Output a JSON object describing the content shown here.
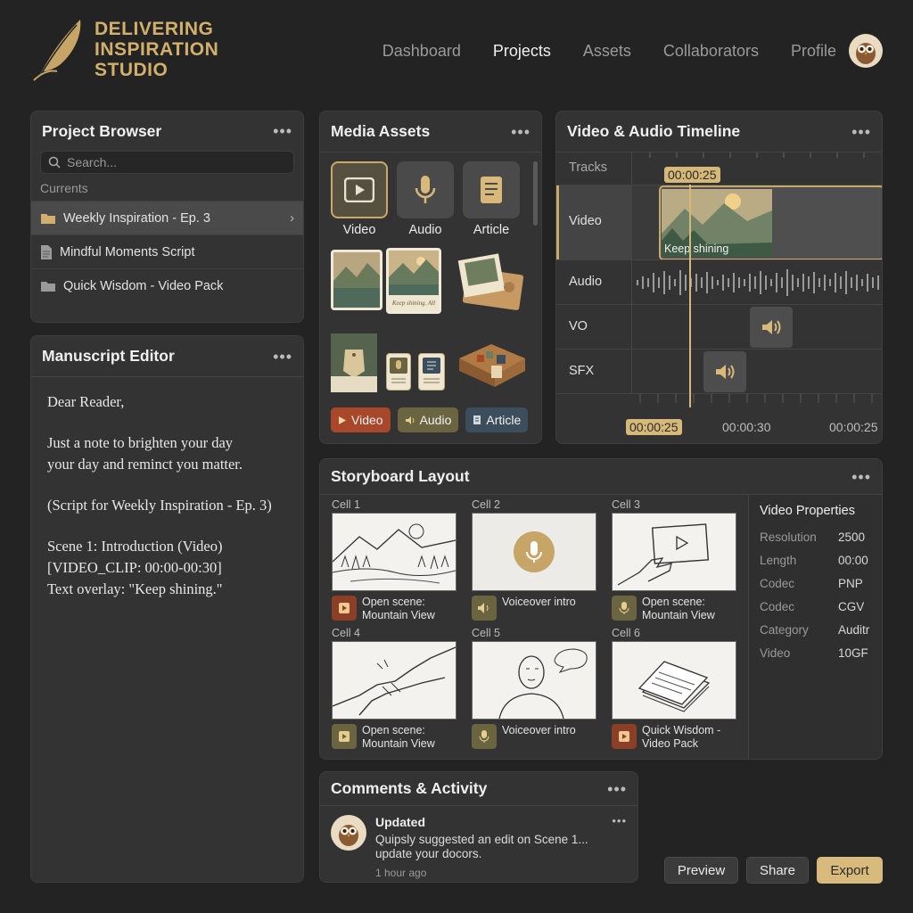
{
  "brand": {
    "line1": "DELIVERING",
    "line2": "INSPIRATION",
    "line3": "STUDIO",
    "color": "#d2b06b"
  },
  "nav": {
    "items": [
      "Dashboard",
      "Projects",
      "Assets",
      "Collaborators",
      "Profile"
    ],
    "active": "Projects"
  },
  "project_browser": {
    "title": "Project Browser",
    "search_placeholder": "Search...",
    "section": "Currents",
    "items": [
      {
        "label": "Weekly Inspiration - Ep. 3",
        "icon": "folder-icon"
      },
      {
        "label": "Mindful Moments Script",
        "icon": "document-icon"
      },
      {
        "label": "Quick Wisdom - Video Pack",
        "icon": "folder-icon"
      }
    ]
  },
  "manuscript": {
    "title": "Manuscript Editor",
    "paragraphs": [
      "Dear Reader,",
      "Just a note to brighten your day\nyour day and reminct you matter.",
      "(Script for Weekly Inspiration - Ep. 3)",
      "Scene 1: Introduction (Video)\n[VIDEO_CLIP: 00:00-00:30]\nText overlay: \"Keep shining.\""
    ]
  },
  "media_assets": {
    "title": "Media Assets",
    "tabs": [
      "Video",
      "Audio",
      "Article"
    ],
    "thumb_caption": "Keep shining. All",
    "chips": [
      "Video",
      "Audio",
      "Article"
    ],
    "chip_colors": [
      "#a9472b",
      "#6b6440",
      "#3c4d5c"
    ]
  },
  "timeline": {
    "title": "Video & Audio Timeline",
    "tracks_label": "Tracks",
    "rows": [
      "Video",
      "Audio",
      "VO",
      "SFX"
    ],
    "playhead_time": "00:00:25",
    "clip_caption": "Keep shining",
    "ruler": [
      "00:00:25",
      "00:00:30",
      "00:00:25"
    ]
  },
  "storyboard": {
    "title": "Storyboard Layout",
    "cells": [
      {
        "label": "Cell 1",
        "caption": "Open scene:\nMountain View",
        "icon": "play-icon"
      },
      {
        "label": "Cell 2",
        "caption": "Voiceover intro",
        "icon": "speaker-icon"
      },
      {
        "label": "Cell 3",
        "caption": "Open scene:\nMountain View",
        "icon": "microphone-icon"
      },
      {
        "label": "Cell 4",
        "caption": "Open scene:\nMountain View",
        "icon": "play-icon"
      },
      {
        "label": "Cell 5",
        "caption": "Voiceover intro",
        "icon": "microphone-icon"
      },
      {
        "label": "Cell 6",
        "caption": "Quick Wisdom -\nVideo Pack",
        "icon": "play-icon"
      }
    ],
    "properties": {
      "title": "Video Properties",
      "rows": [
        {
          "key": "Resolution",
          "value": "2500"
        },
        {
          "key": "Length",
          "value": "00:00"
        },
        {
          "key": "Codec",
          "value": "PNP"
        },
        {
          "key": "Codec",
          "value": "CGV"
        },
        {
          "key": "Category",
          "value": "Auditr"
        },
        {
          "key": "Video",
          "value": "10GF"
        }
      ]
    }
  },
  "comments": {
    "title": "Comments & Activity",
    "item": {
      "title": "Updated",
      "text": "Quipsly suggested an edit on Scene 1...\nupdate your docors.",
      "time": "1 hour ago"
    }
  },
  "actions": {
    "preview": "Preview",
    "share": "Share",
    "export": "Export"
  }
}
